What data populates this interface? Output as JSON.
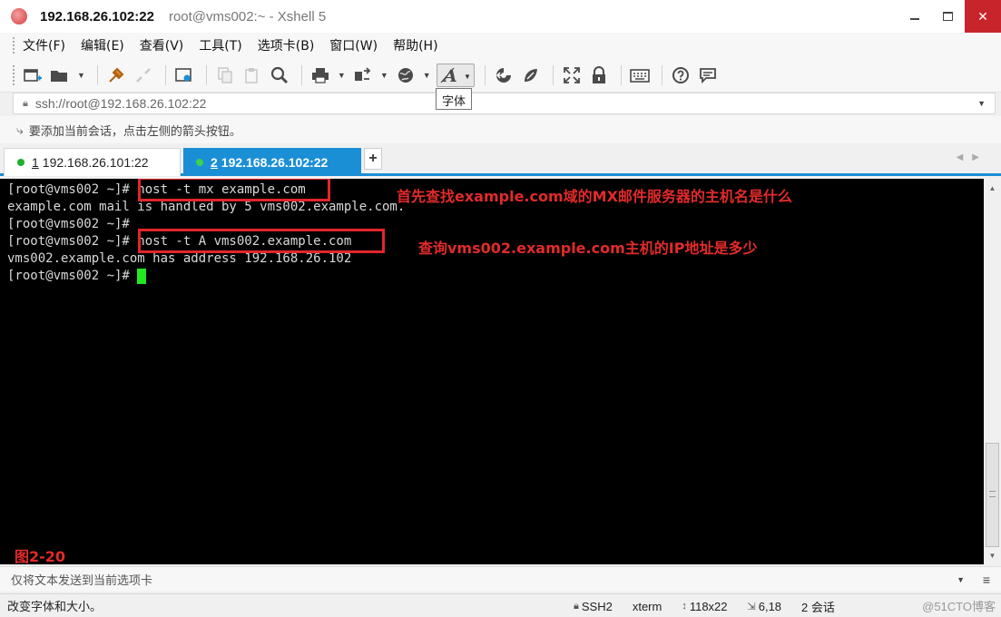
{
  "window": {
    "title_ip": "192.168.26.102:22",
    "title_rest": "root@vms002:~ - Xshell 5",
    "minimize": "—",
    "close": "✕"
  },
  "menu": [
    "文件(F)",
    "编辑(E)",
    "查看(V)",
    "工具(T)",
    "选项卡(B)",
    "窗口(W)",
    "帮助(H)"
  ],
  "toolbar": {
    "icons": [
      "new-session-icon",
      "open-folder-icon",
      "reconnect-icon",
      "disconnect-icon",
      "properties-icon",
      "copy-icon",
      "paste-icon",
      "find-icon",
      "print-icon",
      "transfer-icon",
      "globe-icon",
      "font-icon",
      "xftp-icon",
      "xmanager-icon",
      "fullscreen-icon",
      "lock-icon",
      "keyboard-icon",
      "help-icon",
      "chat-icon"
    ],
    "tooltip": "字体"
  },
  "address": {
    "value": "ssh://root@192.168.26.102:22"
  },
  "hint": "要添加当前会话，点击左侧的箭头按钮。",
  "tabs": [
    {
      "num": "1",
      "label": "192.168.26.101:22",
      "active": false
    },
    {
      "num": "2",
      "label": "192.168.26.102:22",
      "active": true
    }
  ],
  "tab_add": "+",
  "terminal": {
    "lines": [
      "[root@vms002 ~]# host -t mx example.com",
      "example.com mail is handled by 5 vms002.example.com.",
      "[root@vms002 ~]#",
      "[root@vms002 ~]# host -t A vms002.example.com",
      "vms002.example.com has address 192.168.26.102",
      "[root@vms002 ~]# "
    ],
    "annotations": [
      "首先查找example.com域的MX邮件服务器的主机名是什么",
      "查询vms002.example.com主机的IP地址是多少"
    ],
    "figure_label": "图2-20"
  },
  "sendbar": {
    "text": "仅将文本发送到当前选项卡"
  },
  "status": {
    "message": "改变字体和大小。",
    "protocol": "SSH2",
    "term": "xterm",
    "size": "118x22",
    "cursor_pos": "6,18",
    "sessions": "2 会话",
    "watermark": "@51CTO博客"
  },
  "colors": {
    "tab_active": "#1b8fd6",
    "annotation": "#e22a2a",
    "cursor": "#22e822",
    "close_button": "#c7252b"
  }
}
